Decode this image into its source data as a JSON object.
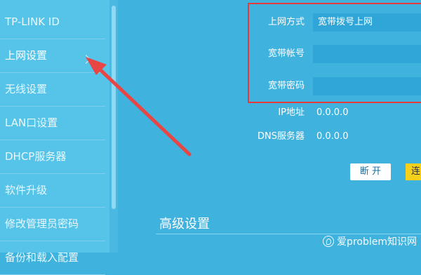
{
  "sidebar": {
    "items": [
      {
        "label": "TP-LINK ID"
      },
      {
        "label": "上网设置"
      },
      {
        "label": "无线设置"
      },
      {
        "label": "LAN口设置"
      },
      {
        "label": "DHCP服务器"
      },
      {
        "label": "软件升级"
      },
      {
        "label": "修改管理员密码"
      },
      {
        "label": "备份和载入配置"
      }
    ],
    "active_index": 1
  },
  "wan_form": {
    "connection_type": {
      "label": "上网方式",
      "value": "宽带拨号上网"
    },
    "username": {
      "label": "宽带帐号",
      "value": ""
    },
    "password": {
      "label": "宽带密码",
      "value": ""
    }
  },
  "status": {
    "ip": {
      "label": "IP地址",
      "value": "0.0.0.0"
    },
    "dns": {
      "label": "DNS服务器",
      "value": "0.0.0.0"
    }
  },
  "buttons": {
    "disconnect": "断 开",
    "connect_partial": "连"
  },
  "advanced_title": "高级设置",
  "watermark": "爱problem知识网",
  "colors": {
    "background": "#3fb2dd",
    "sidebar": "#56c3e8",
    "highlight_box": "#e83a3a",
    "arrow": "#e84545",
    "accent_button": "#f6d11b"
  }
}
